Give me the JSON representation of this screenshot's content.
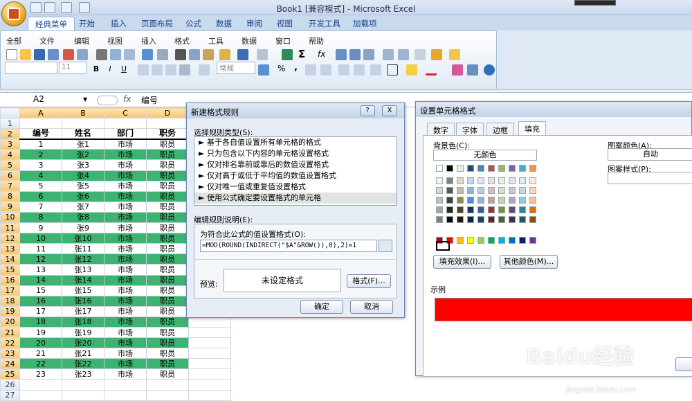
{
  "window": {
    "title": "Book1  [兼容模式] - Microsoft Excel"
  },
  "ribbon_tabs": [
    "经典菜单",
    "开始",
    "插入",
    "页面布局",
    "公式",
    "数据",
    "审阅",
    "视图",
    "开发工具",
    "加载项"
  ],
  "menu_items": [
    "全部",
    "文件",
    "编辑",
    "视图",
    "插入",
    "格式",
    "工具",
    "数据",
    "窗口",
    "帮助"
  ],
  "toolbar": {
    "font_size": "11",
    "number_format": "常规",
    "percent": "%",
    "comma": ",",
    "sigma": "Σ",
    "fx": "fx"
  },
  "formula_bar": {
    "name_box": "A2",
    "fx": "fx",
    "value": "编号"
  },
  "sheet": {
    "columns": [
      "A",
      "B",
      "C",
      "D",
      "E"
    ],
    "rows": [
      "1",
      "2",
      "3",
      "4",
      "5",
      "6",
      "7",
      "8",
      "9",
      "10",
      "11",
      "12",
      "13",
      "14",
      "15",
      "16",
      "17",
      "18",
      "19",
      "20",
      "21",
      "22",
      "23",
      "24",
      "25",
      "26",
      "27"
    ],
    "header": [
      "编号",
      "姓名",
      "部门",
      "职务"
    ],
    "data": [
      [
        "1",
        "张1",
        "市场",
        "职员"
      ],
      [
        "2",
        "张2",
        "市场",
        "职员"
      ],
      [
        "3",
        "张3",
        "市场",
        "职员"
      ],
      [
        "4",
        "张4",
        "市场",
        "职员"
      ],
      [
        "5",
        "张5",
        "市场",
        "职员"
      ],
      [
        "6",
        "张6",
        "市场",
        "职员"
      ],
      [
        "7",
        "张7",
        "市场",
        "职员"
      ],
      [
        "8",
        "张8",
        "市场",
        "职员"
      ],
      [
        "9",
        "张9",
        "市场",
        "职员"
      ],
      [
        "10",
        "张10",
        "市场",
        "职员"
      ],
      [
        "11",
        "张11",
        "市场",
        "职员"
      ],
      [
        "12",
        "张12",
        "市场",
        "职员"
      ],
      [
        "13",
        "张13",
        "市场",
        "职员"
      ],
      [
        "14",
        "张14",
        "市场",
        "职员"
      ],
      [
        "15",
        "张15",
        "市场",
        "职员"
      ],
      [
        "16",
        "张16",
        "市场",
        "职员"
      ],
      [
        "17",
        "张17",
        "市场",
        "职员"
      ],
      [
        "18",
        "张18",
        "市场",
        "职员"
      ],
      [
        "19",
        "张19",
        "市场",
        "职员"
      ],
      [
        "20",
        "张20",
        "市场",
        "职员"
      ],
      [
        "21",
        "张21",
        "市场",
        "职员"
      ],
      [
        "22",
        "张22",
        "市场",
        "职员"
      ],
      [
        "23",
        "张23",
        "市场",
        "职员"
      ]
    ],
    "highlight_color": "#3cb371"
  },
  "new_rule_dialog": {
    "title": "新建格式规则",
    "help": "?",
    "close": "X",
    "rule_type_label": "选择规则类型(S):",
    "rule_types": [
      "► 基于各自值设置所有单元格的格式",
      "► 只为包含以下内容的单元格设置格式",
      "► 仅对排名靠前或靠后的数值设置格式",
      "► 仅对高于或低于平均值的数值设置格式",
      "► 仅对唯一值或重复值设置格式",
      "► 使用公式确定要设置格式的单元格"
    ],
    "desc_label": "编辑规则说明(E):",
    "formula_label": "为符合此公式的值设置格式(O):",
    "formula": "=MOD(ROUND(INDIRECT(\"$A\"&ROW()),0),2)=1",
    "preview_label": "预览:",
    "preview_text": "未设定格式",
    "format_button": "格式(F)...",
    "ok": "确定",
    "cancel": "取消"
  },
  "format_cells_dialog": {
    "title": "设置单元格格式",
    "tabs": [
      "数字",
      "字体",
      "边框",
      "填充"
    ],
    "bg_label": "背景色(C):",
    "no_color": "无颜色",
    "pattern_color_label": "图案颜色(A):",
    "pattern_color_value": "自动",
    "pattern_style_label": "图案样式(P):",
    "fill_effects": "填充效果(I)...",
    "more_colors": "其他颜色(M)...",
    "sample_label": "示例",
    "sample_color": "#ff0000"
  },
  "watermark": {
    "text": "Baidu经验",
    "url": "jingyan.baidu.com"
  }
}
